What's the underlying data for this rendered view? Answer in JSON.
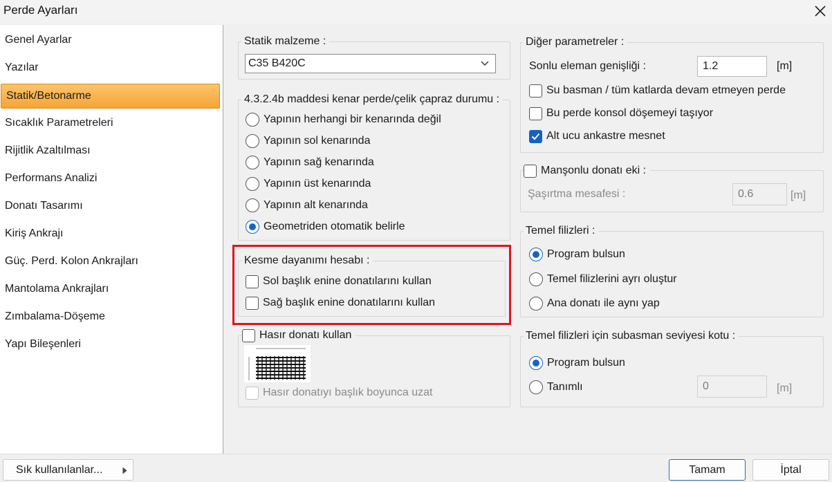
{
  "window": {
    "title": "Perde Ayarları"
  },
  "sidebar": {
    "items": [
      {
        "label": "Genel Ayarlar"
      },
      {
        "label": "Yazılar"
      },
      {
        "label": "Statik/Betonarme"
      },
      {
        "label": "Sıcaklık Parametreleri"
      },
      {
        "label": "Rijitlik Azaltılması"
      },
      {
        "label": "Performans Analizi"
      },
      {
        "label": "Donatı Tasarımı"
      },
      {
        "label": "Kiriş Ankrajı"
      },
      {
        "label": "Güç. Perd. Kolon Ankrajları"
      },
      {
        "label": "Mantolama Ankrajları"
      },
      {
        "label": "Zımbalama-Döşeme"
      },
      {
        "label": "Yapı Bileşenleri"
      }
    ],
    "selected": "Statik/Betonarme"
  },
  "statik": {
    "title": "Statik malzeme :",
    "value": "C35 B420C"
  },
  "kenar": {
    "title": "4.3.2.4b maddesi kenar perde/çelik çapraz durumu :",
    "options": [
      "Yapının herhangi bir kenarında değil",
      "Yapının sol kenarında",
      "Yapının sağ kenarında",
      "Yapının üst kenarında",
      "Yapının alt kenarında",
      "Geometriden otomatik belirle"
    ],
    "selected": "Geometriden otomatik belirle"
  },
  "kesme": {
    "title": "Kesme dayanımı hesabı :",
    "options": [
      "Sol başlık enine donatılarını kullan",
      "Sağ başlık enine donatılarını kullan"
    ],
    "highlight_color": "#e0141e"
  },
  "hasir": {
    "title": "Hasır donatı kullan",
    "image": "mesh-reinforcement-diagram",
    "extend_label": "Hasır donatıyı başlık boyunca uzat"
  },
  "diger": {
    "title": "Diğer parametreler :",
    "width_label": "Sonlu eleman genişliği :",
    "width_value": "1.2",
    "width_unit": "[m]",
    "checks": [
      {
        "label": "Su basman / tüm katlarda devam etmeyen perde",
        "checked": false
      },
      {
        "label": "Bu perde konsol döşemeyi taşıyor",
        "checked": false
      },
      {
        "label": "Alt ucu ankastre mesnet",
        "checked": true
      }
    ]
  },
  "manson": {
    "title": "Manşonlu donatı eki :",
    "field_label": "Şaşırtma mesafesi :",
    "field_value": "0.6",
    "field_unit": "[m]"
  },
  "temel": {
    "title": "Temel filizleri :",
    "options": [
      "Program bulsun",
      "Temel filizlerini ayrı oluştur",
      "Ana donatı ile aynı yap"
    ],
    "selected": "Program bulsun"
  },
  "subasman": {
    "title": "Temel filizleri için subasman seviyesi kotu  :",
    "options": [
      "Program bulsun",
      "Tanımlı"
    ],
    "selected": "Program bulsun",
    "value": "0",
    "unit": "[m]"
  },
  "footer": {
    "favorites": "Sık kullanılanlar...",
    "ok": "Tamam",
    "cancel": "İptal"
  },
  "colors": {
    "accent": "#1565c0",
    "selected_item": "#f6a534"
  }
}
